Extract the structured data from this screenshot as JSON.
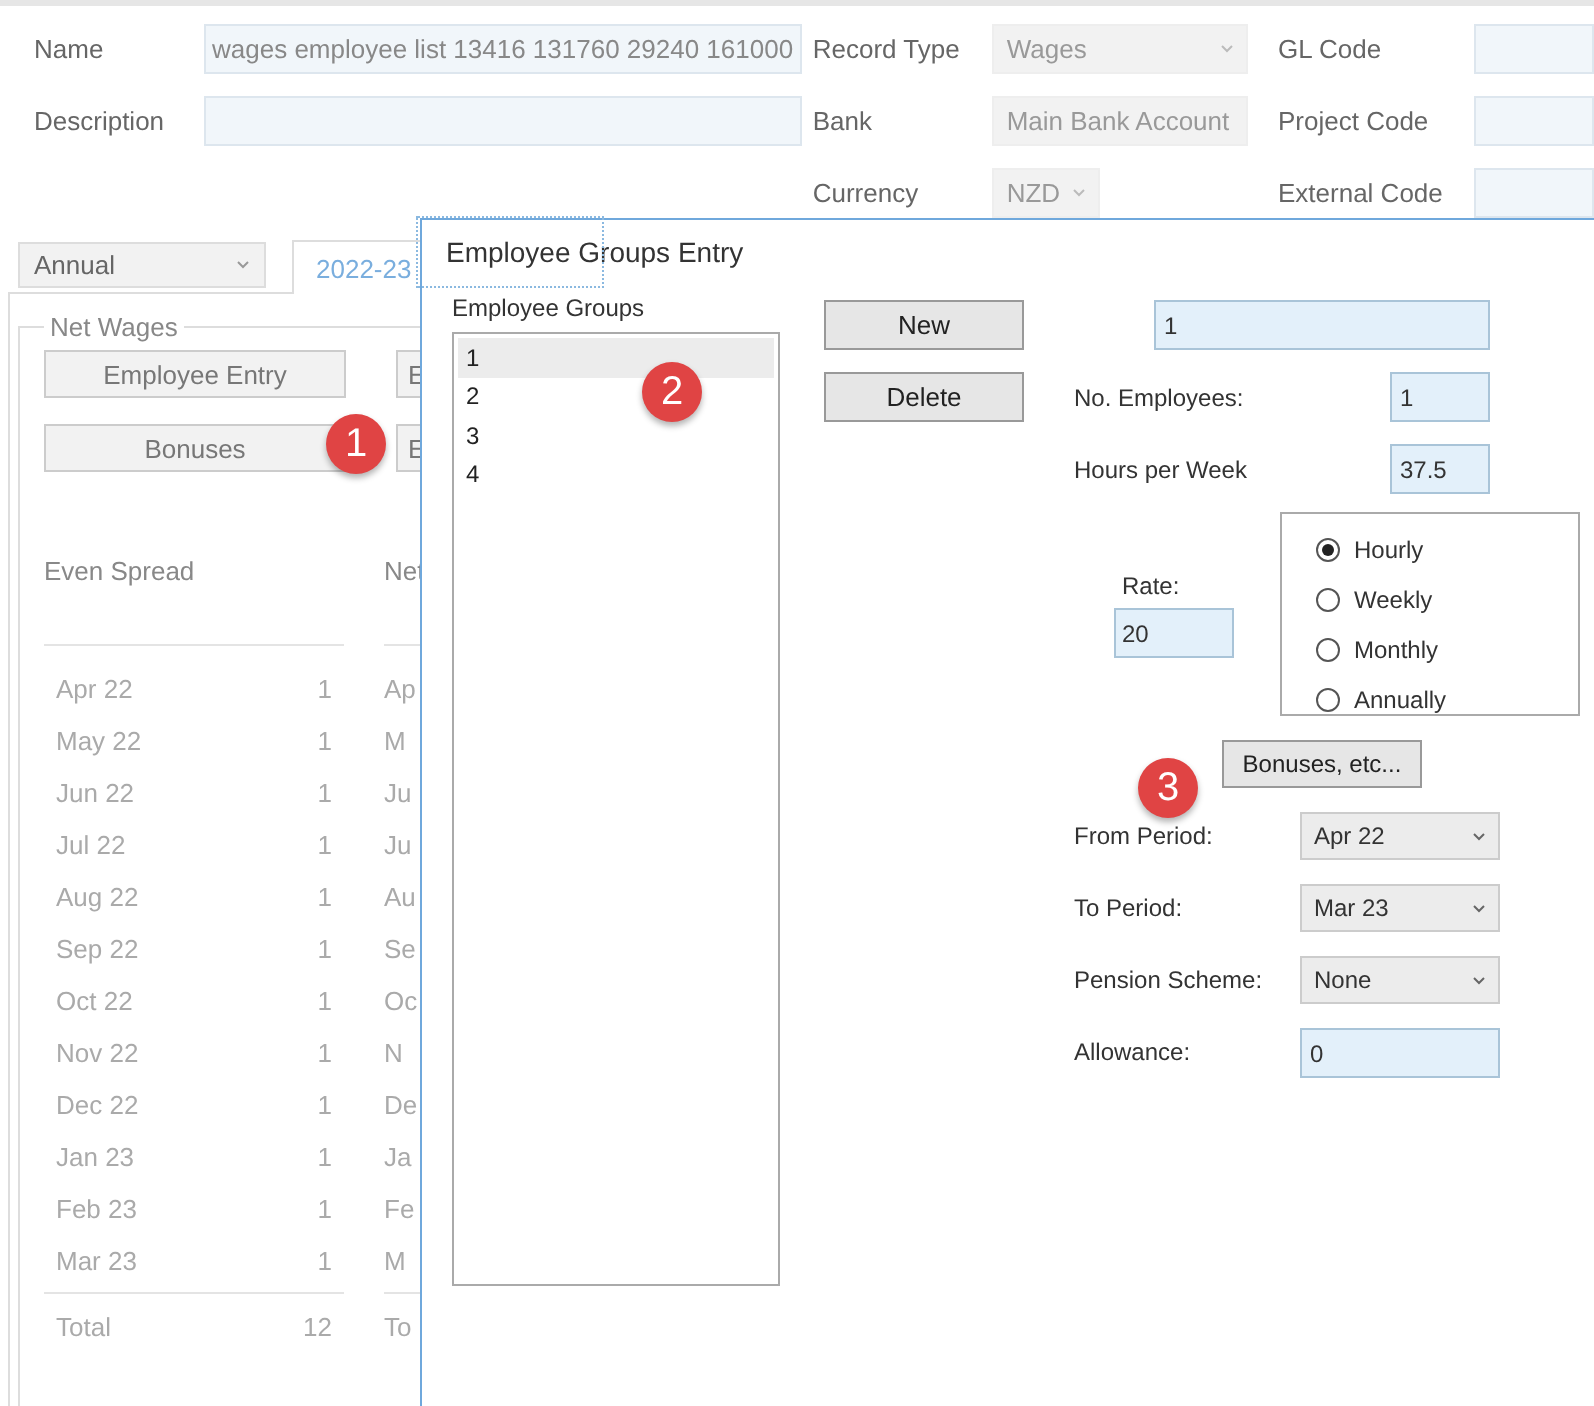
{
  "form_columns": [
    {
      "fields": [
        {
          "label": "Name",
          "kind": "text",
          "value": "wages employee list 13416 131760 29240 161000"
        },
        {
          "label": "Description",
          "kind": "text"
        }
      ]
    },
    {
      "fields": [
        {
          "label": "Record Type",
          "kind": "dropdown",
          "value": "Wages"
        },
        {
          "label": "Bank",
          "kind": "dropdown",
          "value": "Main Bank Account"
        },
        {
          "label": "Currency",
          "kind": "dropdown",
          "value": "NZD"
        }
      ]
    },
    {
      "fields": [
        {
          "label": "GL Code",
          "kind": "text"
        },
        {
          "label": "Project Code",
          "kind": "text"
        },
        {
          "label": "External Code",
          "kind": "text"
        }
      ]
    }
  ],
  "period_dropdown": "Annual",
  "tabs": [
    {
      "label": "2022-23",
      "selected": true
    }
  ],
  "net_wages": {
    "title": "Net Wages",
    "buttons": [
      {
        "label": "Employee Entry",
        "partial": "E"
      },
      {
        "label": "Bonuses",
        "partial": "E"
      }
    ],
    "columns": [
      {
        "header": "Even Spread",
        "total_label": "Total",
        "total_value": "12",
        "rows": [
          {
            "month": "Apr 22",
            "value": "1"
          },
          {
            "month": "May 22",
            "value": "1"
          },
          {
            "month": "Jun 22",
            "value": "1"
          },
          {
            "month": "Jul 22",
            "value": "1"
          },
          {
            "month": "Aug 22",
            "value": "1"
          },
          {
            "month": "Sep 22",
            "value": "1"
          },
          {
            "month": "Oct 22",
            "value": "1"
          },
          {
            "month": "Nov 22",
            "value": "1"
          },
          {
            "month": "Dec 22",
            "value": "1"
          },
          {
            "month": "Jan 23",
            "value": "1"
          },
          {
            "month": "Feb 23",
            "value": "1"
          },
          {
            "month": "Mar 23",
            "value": "1"
          }
        ]
      },
      {
        "header": "Net",
        "total_label": "To",
        "rows": [
          {
            "month": "Ap"
          },
          {
            "month": "M"
          },
          {
            "month": "Ju"
          },
          {
            "month": "Ju"
          },
          {
            "month": "Au"
          },
          {
            "month": "Se"
          },
          {
            "month": "Oc"
          },
          {
            "month": "N"
          },
          {
            "month": "De"
          },
          {
            "month": "Ja"
          },
          {
            "month": "Fe"
          },
          {
            "month": "M"
          }
        ]
      }
    ]
  },
  "dialog": {
    "title": "Employee Groups Entry",
    "list_label": "Employee Groups",
    "groups": [
      {
        "label": "1",
        "selected": true
      },
      {
        "label": "2",
        "selected": false
      },
      {
        "label": "3",
        "selected": false
      },
      {
        "label": "4",
        "selected": false
      }
    ],
    "buttons": [
      "New",
      "Delete"
    ],
    "group_name": "1",
    "employees": {
      "label": "No. Employees:",
      "value": "1"
    },
    "hours": {
      "label": "Hours per Week",
      "value": "37.5"
    },
    "rate": {
      "label": "Rate:",
      "value": "20"
    },
    "rate_types": [
      {
        "label": "Hourly",
        "selected": true
      },
      {
        "label": "Weekly",
        "selected": false
      },
      {
        "label": "Monthly",
        "selected": false
      },
      {
        "label": "Annually",
        "selected": false
      }
    ],
    "bonuses_button": "Bonuses, etc...",
    "settings": [
      {
        "label": "From Period:",
        "kind": "dropdown",
        "value": "Apr 22"
      },
      {
        "label": "To Period:",
        "kind": "dropdown",
        "value": "Mar 23"
      },
      {
        "label": "Pension Scheme:",
        "kind": "dropdown",
        "value": "None"
      },
      {
        "label": "Allowance:",
        "kind": "text",
        "value": "0"
      }
    ]
  },
  "badges": [
    "1",
    "2",
    "3"
  ]
}
